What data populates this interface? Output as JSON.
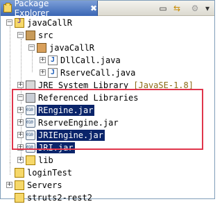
{
  "panel": {
    "title": "Package Explorer",
    "close_glyph": "✖"
  },
  "toolbar": {
    "collapse_glyph": "▭",
    "link_glyph": "⇆",
    "menu_glyph": "⚙",
    "overflow_glyph": "▾"
  },
  "tree": {
    "project": "javaCallR",
    "src": "src",
    "package": "javaCallR",
    "file1": "DllCall.java",
    "file2": "RserveCall.java",
    "jre": "JRE System Library",
    "jre_deco": "[JavaSE-1.8]",
    "ref_libs": "Referenced Libraries",
    "jars": [
      "REngine.jar",
      "RserveEngine.jar",
      "JRIEngine.jar",
      "JRI.jar"
    ],
    "lib": "lib",
    "loginTest": "loginTest",
    "servers": "Servers",
    "struts": "struts2-rest2"
  },
  "selected_jars": [
    "REngine.jar",
    "JRIEngine.jar",
    "JRI.jar"
  ],
  "colors": {
    "selection": "#0a246a",
    "highlight_box": "#e0354b",
    "tab": "#3a66b4"
  }
}
